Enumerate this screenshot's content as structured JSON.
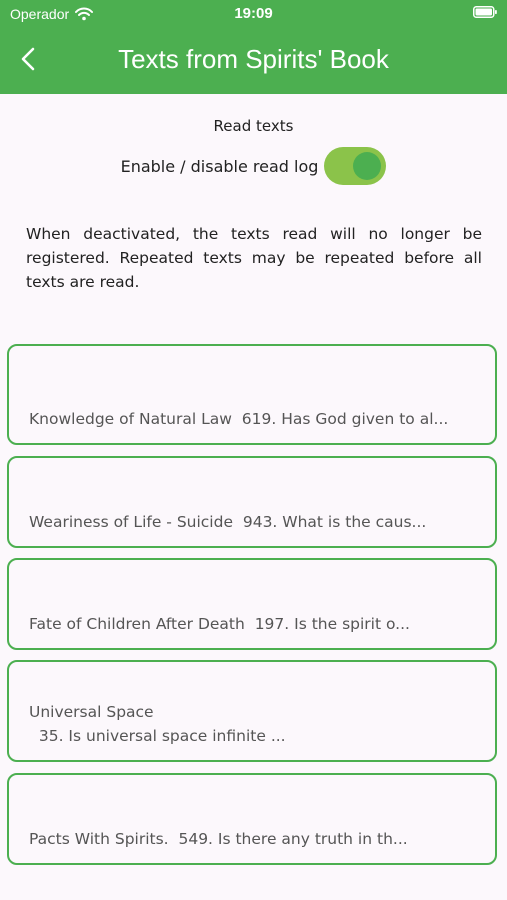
{
  "status": {
    "carrier": "Operador",
    "time": "19:09"
  },
  "header": {
    "title": "Texts from Spirits' Book"
  },
  "settings": {
    "section_label": "Read texts",
    "toggle_label": "Enable / disable read log",
    "toggle_on": true,
    "description": "When deactivated, the texts read will no longer be registered. Repeated texts may be repeated before all texts are read."
  },
  "texts": [
    {
      "label": "Knowledge of Natural Law  619. Has God given to al..."
    },
    {
      "label": "Weariness of Life - Suicide  943. What is the caus..."
    },
    {
      "label": "Fate of Children After Death  197. Is the spirit o..."
    },
    {
      "label": "Universal Space\n  35. Is universal space infinite ..."
    },
    {
      "label": "Pacts With Spirits.  549. Is there any truth in th..."
    }
  ],
  "colors": {
    "primary": "#4caf50",
    "toggle_track": "#8bc34a",
    "background": "#fcf8fc"
  }
}
